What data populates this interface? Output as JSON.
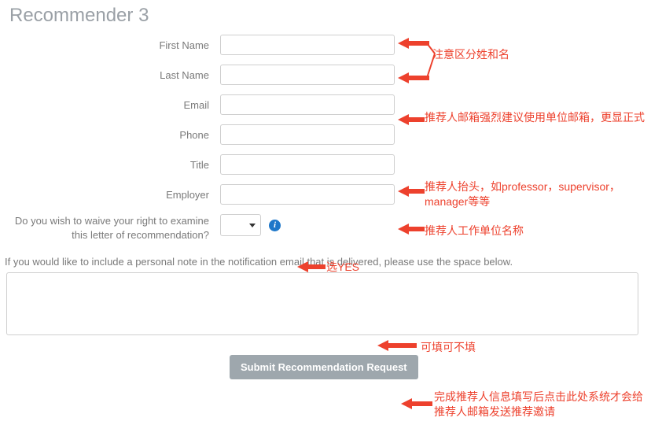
{
  "heading": "Recommender 3",
  "fields": {
    "first_name": {
      "label": "First Name",
      "value": ""
    },
    "last_name": {
      "label": "Last Name",
      "value": ""
    },
    "email": {
      "label": "Email",
      "value": ""
    },
    "phone": {
      "label": "Phone",
      "value": ""
    },
    "title": {
      "label": "Title",
      "value": ""
    },
    "employer": {
      "label": "Employer",
      "value": ""
    }
  },
  "waive": {
    "label": "Do you wish to waive your right to examine this letter of recommendation?",
    "value": ""
  },
  "info_icon_glyph": "i",
  "note_instruction": "If you would like to include a personal note in the notification email that is delivered, please use the space below.",
  "personal_note": "",
  "submit_label": "Submit Recommendation Request",
  "annotations": {
    "name_hint": "注意区分姓和名",
    "email_hint": "推荐人邮箱强烈建议使用单位邮箱，更显正式",
    "title_hint": "推荐人抬头，如professor，supervisor，manager等等",
    "employer_hint": "推荐人工作单位名称",
    "waive_hint": "选YES",
    "note_hint": "可填可不填",
    "submit_hint": "完成推荐人信息填写后点击此处系统才会给推荐人邮箱发送推荐邀请"
  }
}
